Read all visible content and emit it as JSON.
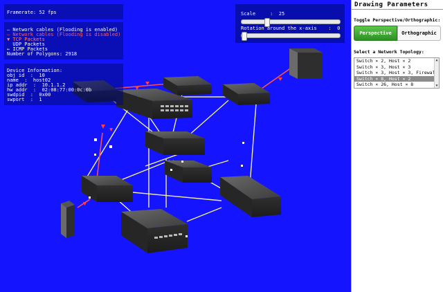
{
  "overlay": {
    "framerate": "Framerate: 52 fps",
    "legend": [
      "— Network cables (Flooding is enabled)",
      "— Network cables (Flooding is disabled)",
      "▼ TCP Packets",
      "  UDP Packets",
      "← ICMP Packets",
      "Number of Polygons: 2918"
    ],
    "device_info": [
      "Device Information:",
      "obj id  :  10",
      "name  :  host02",
      "ip addr  :  10.1.1.2",
      "hw addr  :  02:08:77:00:0c:0b",
      "swdpid  :  0x00",
      "swport  :  1"
    ],
    "legend_colors": {
      "flooding_enabled": "#ffffff",
      "flooding_disabled": "#ff3030",
      "tcp": "#ff4040",
      "udp": "#ffffff",
      "icmp": "#ffffff"
    }
  },
  "controls": {
    "scale_label": "Scale     :  25",
    "scale_value": 25,
    "rotation_label": "Rotation around the x-axis    :  0",
    "rotation_value": 0
  },
  "sidebar": {
    "title": "Drawing Parameters",
    "toggle_label": "Toggle Perspective/Orthographic:",
    "perspective_button": "Perspective",
    "orthographic_button": "Orthographic",
    "active_mode": "Perspective",
    "topology_label": "Select a Network Topology:",
    "topologies": [
      "Switch × 2, Host × 2",
      "Switch × 3, Host × 3",
      "Switch × 3, Host × 3, Firewall × 1",
      "Switch × 8, Host × 2",
      "Switch × 26, Host × 8"
    ],
    "selected_topology_index": 3
  },
  "scene": {
    "background": "#1414ff",
    "cable_color": "#f2f0a0"
  }
}
